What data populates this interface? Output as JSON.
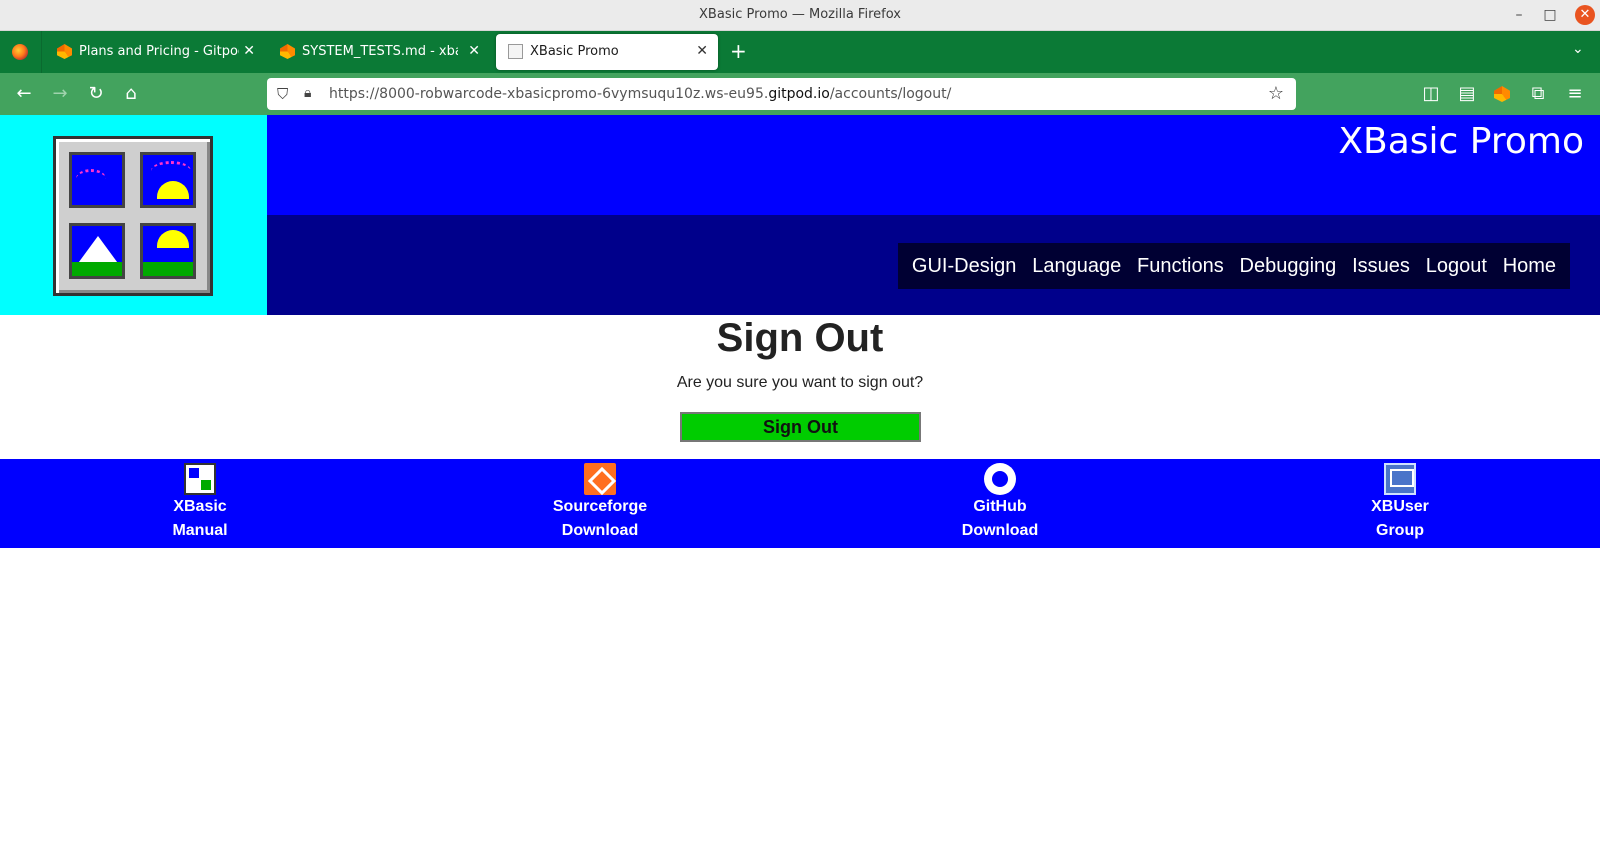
{
  "window": {
    "title": "XBasic Promo — Mozilla Firefox",
    "minimize": "–",
    "maximize": "□",
    "close": "✕"
  },
  "tabs": [
    {
      "label": "Plans and Pricing - Gitpod",
      "close": "✕",
      "favicon": "gitpod-icon"
    },
    {
      "label": "SYSTEM_TESTS.md - xbasic-promo",
      "close": "✕",
      "favicon": "gitpod-icon"
    },
    {
      "label": "XBasic Promo",
      "close": "✕",
      "favicon": "xbasic-icon",
      "active": true
    }
  ],
  "tabstrip": {
    "new_tab": "+",
    "list_all_tabs": "⌄"
  },
  "navbar": {
    "back": "←",
    "forward": "→",
    "reload": "↻",
    "home": "⌂",
    "url_prefix": "https://8000-robwarcode-xbasicpromo-6vymsuqu10z.ws-eu95.",
    "url_domain": "gitpod.io",
    "url_path": "/accounts/logout/",
    "bookmark": "☆",
    "pocket": "◫",
    "reader": "▤",
    "extensions": "⧉",
    "menu": "≡"
  },
  "site": {
    "title": "XBasic Promo",
    "menu": [
      "GUI-Design",
      "Language",
      "Functions",
      "Debugging",
      "Issues",
      "Logout",
      "Home"
    ]
  },
  "main": {
    "heading": "Sign Out",
    "text": "Are you sure you want to sign out?",
    "button": "Sign Out"
  },
  "footer": [
    {
      "line1": "XBasic",
      "line2": "Manual",
      "icon": "xbasic-manual-icon"
    },
    {
      "line1": "Sourceforge",
      "line2": "Download",
      "icon": "sourceforge-icon"
    },
    {
      "line1": "GitHub",
      "line2": "Download",
      "icon": "github-icon"
    },
    {
      "line1": "XBUser",
      "line2": "Group",
      "icon": "mail-icon"
    }
  ],
  "colors": {
    "tabstrip": "#0b7a36",
    "toolbar": "#43a35e",
    "logo_bg": "#00ffff",
    "header_top": "#0000ff",
    "header_bottom": "#00008b",
    "menu_bg": "#000033",
    "signout_button": "#00cc00",
    "footer": "#0000ff"
  }
}
